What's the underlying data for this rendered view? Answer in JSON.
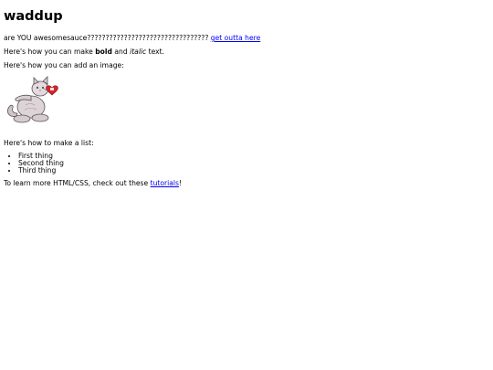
{
  "heading": "waddup",
  "intro": {
    "text": "are YOU awesomesauce????????????????????????????????? ",
    "link": "get outta here"
  },
  "formatting": {
    "before": "Here's how you can make ",
    "bold": "bold",
    "middle": " and ",
    "italic": "italic",
    "after": " text."
  },
  "image_section": {
    "label": "Here's how you can add an image:",
    "image": "plush-cat-holding-heart-tag"
  },
  "list_section": {
    "label": "Here's how to make a list:",
    "items": [
      "First thing",
      "Second thing",
      "Third thing"
    ]
  },
  "learn_more": {
    "before": "To learn more HTML/CSS, check out these ",
    "link": "tutorials",
    "after": "!"
  }
}
